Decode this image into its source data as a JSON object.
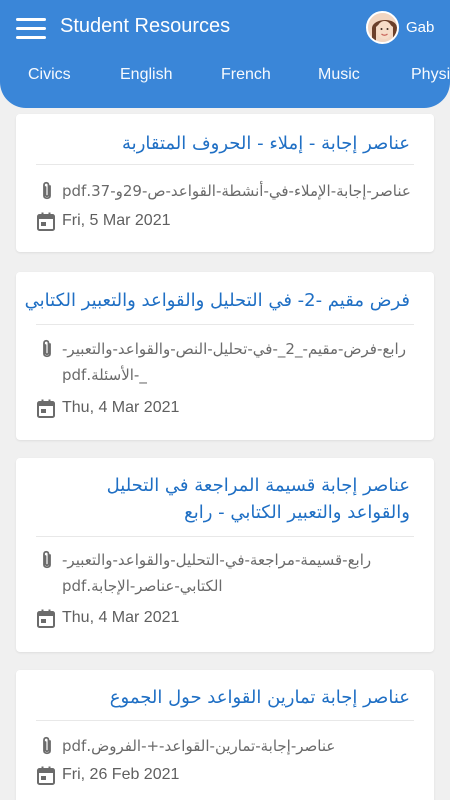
{
  "header": {
    "title": "Student Resources",
    "user_name": "Gab",
    "tabs": [
      "Civics",
      "English",
      "French",
      "Music",
      "Physi"
    ]
  },
  "cards": [
    {
      "title": "عناصر إجابة - إملاء - الحروف المتقاربة",
      "file": "عناصر-إجابة-الإملاء-في-أنشطة-القواعد-ص-29و-37.pdf",
      "date": "Fri, 5 Mar 2021"
    },
    {
      "title": "فرض مقيم -2- في التحليل والقواعد والتعبير الكتابي",
      "file": "رابع-فرض-مقيم-_2_-في-تحليل-النص-والقواعد-والتعبير-_-الأسئلة.pdf",
      "date": "Thu, 4 Mar 2021"
    },
    {
      "title": "عناصر إجابة قسيمة المراجعة في التحليل والقواعد والتعبير الكتابي - رابع",
      "file": "رابع-قسيمة-مراجعة-في-التحليل-والقواعد-والتعبير-الكتابي-عناصر-الإجابة.pdf",
      "date": "Thu, 4 Mar 2021"
    },
    {
      "title": "عناصر إجابة تمارين القواعد حول الجموع",
      "file": "عناصر-إجابة-تمارين-القواعد-+-الفروض.pdf",
      "date": "Fri, 26 Feb 2021"
    }
  ],
  "colors": {
    "header": "#3a86d8",
    "title_link": "#1f6fc4"
  },
  "icons": {
    "menu": "hamburger-icon",
    "attachment": "paperclip-icon",
    "date": "calendar-icon"
  }
}
